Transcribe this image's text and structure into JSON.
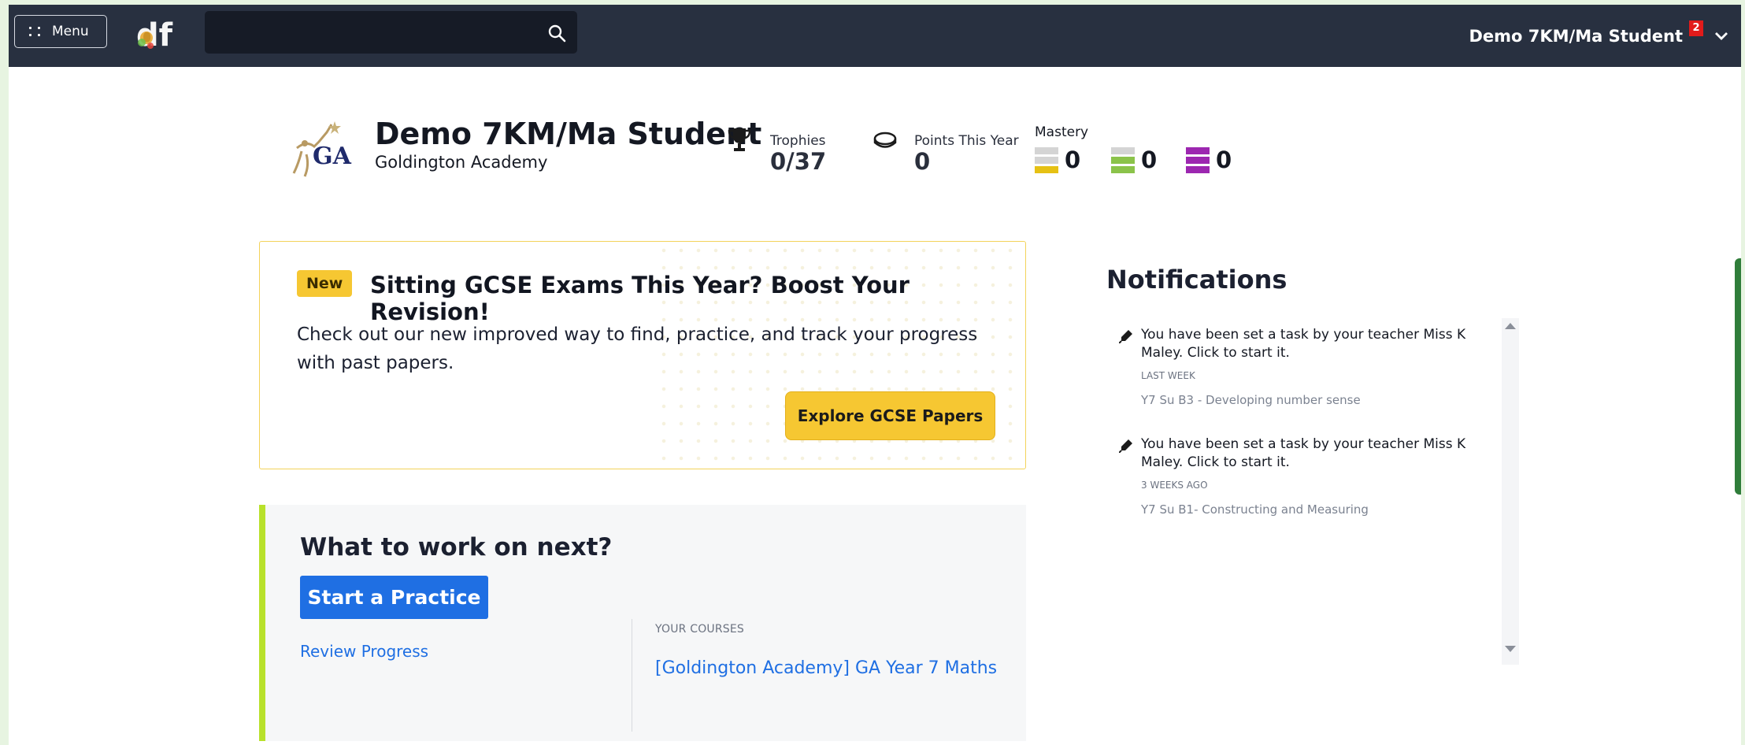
{
  "nav": {
    "menu_label": "Menu",
    "logo_text": "df",
    "search_placeholder": "",
    "user_name": "Demo 7KM/Ma Student",
    "notification_count": "2"
  },
  "profile": {
    "name": "Demo 7KM/Ma Student",
    "school": "Goldington Academy",
    "crest_text": "GA",
    "trophies_label": "Trophies",
    "trophies_value": "0/37",
    "points_label": "Points This Year",
    "points_value": "0",
    "mastery_label": "Mastery",
    "mastery": [
      {
        "value": "0",
        "colors": [
          "#d4d4d4",
          "#d4d4d4",
          "#e6c114"
        ]
      },
      {
        "value": "0",
        "colors": [
          "#d4d4d4",
          "#8bc34a",
          "#8bc34a"
        ]
      },
      {
        "value": "0",
        "colors": [
          "#9c27b0",
          "#9c27b0",
          "#9c27b0"
        ]
      }
    ]
  },
  "promo": {
    "badge": "New",
    "title": "Sitting GCSE Exams This Year? Boost Your Revision!",
    "text": "Check out our new improved way to find, practice, and track your progress with past papers.",
    "button": "Explore GCSE Papers"
  },
  "work": {
    "title": "What to work on next?",
    "start_button": "Start a Practice",
    "review_link": "Review Progress",
    "courses_label": "YOUR COURSES",
    "course": "[Goldington Academy] GA Year 7 Maths"
  },
  "notifications": {
    "title": "Notifications",
    "items": [
      {
        "message": "You have been set a task by your teacher Miss K Maley. Click to start it.",
        "when": "LAST WEEK",
        "task": "Y7 Su B3 - Developing number sense"
      },
      {
        "message": "You have been set a task by your teacher Miss K Maley. Click to start it.",
        "when": "3 WEEKS AGO",
        "task": "Y7 Su B1- Constructing and Measuring"
      }
    ]
  },
  "colors": {
    "nav_bg": "#283040",
    "accent_yellow": "#f6c732",
    "accent_blue": "#1f6fe3",
    "accent_lime": "#b8e12b"
  }
}
